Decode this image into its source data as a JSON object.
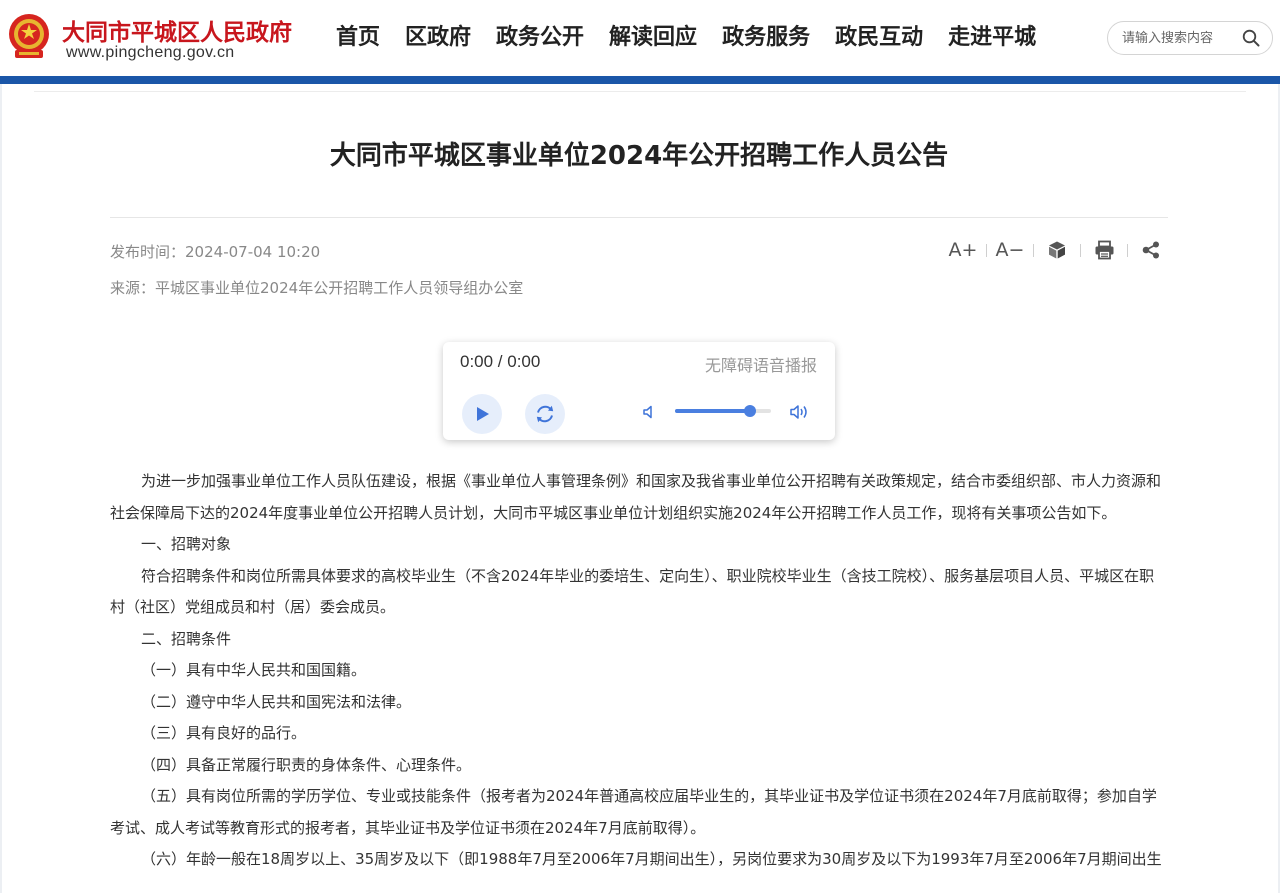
{
  "header": {
    "site_name": "大同市平城区人民政府",
    "site_url": "www.pingcheng.gov.cn",
    "nav": [
      "首页",
      "区政府",
      "政务公开",
      "解读回应",
      "政务服务",
      "政民互动",
      "走进平城"
    ],
    "search_placeholder": "请输入搜索内容"
  },
  "colors": {
    "brand_red": "#c8161d",
    "brand_blue": "#1a56a8",
    "player_accent": "#4a7fe0"
  },
  "article": {
    "title": "大同市平城区事业单位2024年公开招聘工作人员公告",
    "publish_label": "发布时间：",
    "publish_time": "2024-07-04 10:20",
    "source_label": "来源：",
    "source": "平城区事业单位2024年公开招聘工作人员领导组办公室",
    "tools": {
      "font_up": "A+",
      "font_down": "A−",
      "icons": [
        "font-increase-icon",
        "font-decrease-icon",
        "cube-icon",
        "print-icon",
        "share-icon"
      ]
    },
    "player": {
      "time": "0:00 / 0:00",
      "label": "无障碍语音播报",
      "volume": 0.78
    },
    "paragraphs": [
      "为进一步加强事业单位工作人员队伍建设，根据《事业单位人事管理条例》和国家及我省事业单位公开招聘有关政策规定，结合市委组织部、市人力资源和社会保障局下达的2024年度事业单位公开招聘人员计划，大同市平城区事业单位计划组织实施2024年公开招聘工作人员工作，现将有关事项公告如下。",
      "一、招聘对象",
      "符合招聘条件和岗位所需具体要求的高校毕业生（不含2024年毕业的委培生、定向生）、职业院校毕业生（含技工院校）、服务基层项目人员、平城区在职村（社区）党组成员和村（居）委会成员。",
      "二、招聘条件",
      "（一）具有中华人民共和国国籍。",
      "（二）遵守中华人民共和国宪法和法律。",
      "（三）具有良好的品行。",
      "（四）具备正常履行职责的身体条件、心理条件。",
      "（五）具有岗位所需的学历学位、专业或技能条件（报考者为2024年普通高校应届毕业生的，其毕业证书及学位证书须在2024年7月底前取得；参加自学考试、成人考试等教育形式的报考者，其毕业证书及学位证书须在2024年7月底前取得）。",
      "（六）年龄一般在18周岁以上、35周岁及以下（即1988年7月至2006年7月期间出生），另岗位要求为30周岁及以下为1993年7月至2006年7月期间出生"
    ]
  }
}
